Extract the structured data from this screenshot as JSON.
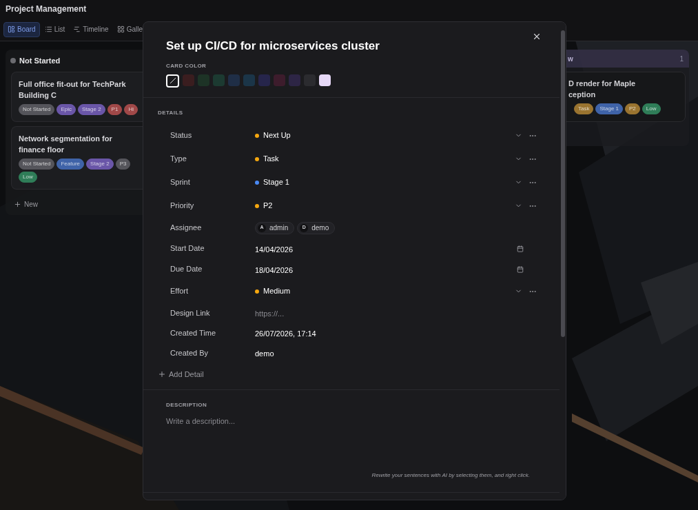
{
  "app_title": "Project Management",
  "views": [
    {
      "label": "Board",
      "selected": true
    },
    {
      "label": "List",
      "selected": false
    },
    {
      "label": "Timeline",
      "selected": false
    },
    {
      "label": "Galle",
      "selected": false
    }
  ],
  "columns": [
    {
      "title": "Not Started",
      "color": "#6b6b70",
      "cards": [
        {
          "title": "Full office fit-out for TechPark Building C",
          "tags": [
            {
              "label": "Not Started",
              "color": "#55555b"
            },
            {
              "label": "Epic",
              "color": "#6a56a8"
            },
            {
              "label": "Stage 2",
              "color": "#6a56a8"
            },
            {
              "label": "P1",
              "color": "#a04848"
            },
            {
              "label": "Hi",
              "color": "#a04848"
            }
          ]
        },
        {
          "title": "Network segmentation for finance floor",
          "tags": [
            {
              "label": "Not Started",
              "color": "#55555b"
            },
            {
              "label": "Feature",
              "color": "#3f63a8"
            },
            {
              "label": "Stage 2",
              "color": "#6a56a8"
            },
            {
              "label": "P3",
              "color": "#55555b"
            },
            {
              "label": "Low",
              "color": "#2f7d58"
            }
          ]
        }
      ],
      "add_label": "New"
    },
    {
      "title": "w",
      "count": "1",
      "cards": [
        {
          "title": "D render for Maple",
          "title_2": "ception",
          "tags": [
            {
              "label": "Task",
              "color": "#9a7430"
            },
            {
              "label": "Stage 1",
              "color": "#3f63a8"
            },
            {
              "label": "P2",
              "color": "#9a7430"
            },
            {
              "label": "Low",
              "color": "#2f7d58"
            }
          ]
        }
      ]
    }
  ],
  "modal": {
    "title": "Set up CI/CD for microservices cluster",
    "card_color_label": "CARD COLOR",
    "swatches": [
      {
        "kind": "none",
        "selected": true
      },
      {
        "color": "#3a1d1f",
        "selected": false
      },
      {
        "color": "#1d3326",
        "selected": false
      },
      {
        "color": "#1c3a31",
        "selected": false
      },
      {
        "color": "#1f2e46",
        "selected": false
      },
      {
        "color": "#1b3548",
        "selected": false
      },
      {
        "color": "#26254b",
        "selected": false
      },
      {
        "color": "#3d1c2c",
        "selected": false
      },
      {
        "color": "#2d2545",
        "selected": false
      },
      {
        "color": "#2b2b2f",
        "selected": false
      },
      {
        "color": "#e6d8f6",
        "selected": false
      }
    ],
    "details_label": "DETAILS",
    "fields": [
      {
        "kind": "select",
        "label": "Status",
        "value": "Next Up",
        "color": "#f5a70f"
      },
      {
        "kind": "select",
        "label": "Type",
        "value": "Task",
        "color": "#f5a70f"
      },
      {
        "kind": "select",
        "label": "Sprint",
        "value": "Stage 1",
        "color": "#4a8af4"
      },
      {
        "kind": "select",
        "label": "Priority",
        "value": "P2",
        "color": "#f5a70f"
      },
      {
        "kind": "people",
        "label": "Assignee",
        "people": [
          {
            "initial": "A",
            "name": "admin"
          },
          {
            "initial": "D",
            "name": "demo"
          }
        ]
      },
      {
        "kind": "date",
        "label": "Start Date",
        "value": "14/04/2026"
      },
      {
        "kind": "date",
        "label": "Due Date",
        "value": "18/04/2026"
      },
      {
        "kind": "select",
        "label": "Effort",
        "value": "Medium",
        "color": "#f5a70f"
      },
      {
        "kind": "link",
        "label": "Design Link",
        "placeholder": "https://..."
      },
      {
        "kind": "text",
        "label": "Created Time",
        "value": "26/07/2026, 17:14"
      },
      {
        "kind": "text",
        "label": "Created By",
        "value": "demo"
      }
    ],
    "add_detail": "Add Detail",
    "description_label": "DESCRIPTION",
    "description_placeholder": "Write a description...",
    "ai_hint": "Rewrite your sentences with AI by selecting them, and right click."
  }
}
